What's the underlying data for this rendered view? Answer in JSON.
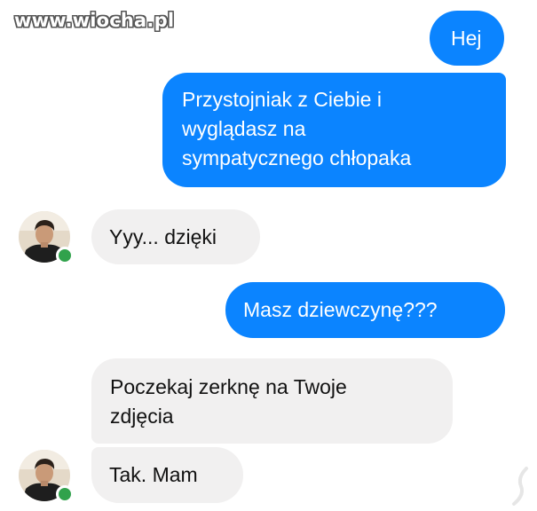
{
  "watermark": {
    "text": "www.wiocha.pl"
  },
  "conversation": {
    "messages": [
      {
        "direction": "outgoing",
        "lines": [
          "Hej"
        ]
      },
      {
        "direction": "outgoing",
        "lines": [
          "Przystojniak z Ciebie i",
          "wyglądasz na",
          "sympatycznego chłopaka"
        ]
      },
      {
        "direction": "incoming",
        "lines": [
          "Yyy... dzięki"
        ]
      },
      {
        "direction": "outgoing",
        "lines": [
          "Masz dziewczynę???"
        ]
      },
      {
        "direction": "incoming",
        "lines": [
          "Poczekaj zerknę na Twoje",
          "zdjęcia"
        ]
      },
      {
        "direction": "incoming",
        "lines": [
          "Tak. Mam"
        ]
      }
    ]
  },
  "colors": {
    "outgoing_bubble": "#0b84ff",
    "incoming_bubble": "#f1f0f0",
    "online_indicator": "#31a24c"
  },
  "icons": {
    "avatar": "contact-avatar",
    "status": "online-status-icon"
  }
}
